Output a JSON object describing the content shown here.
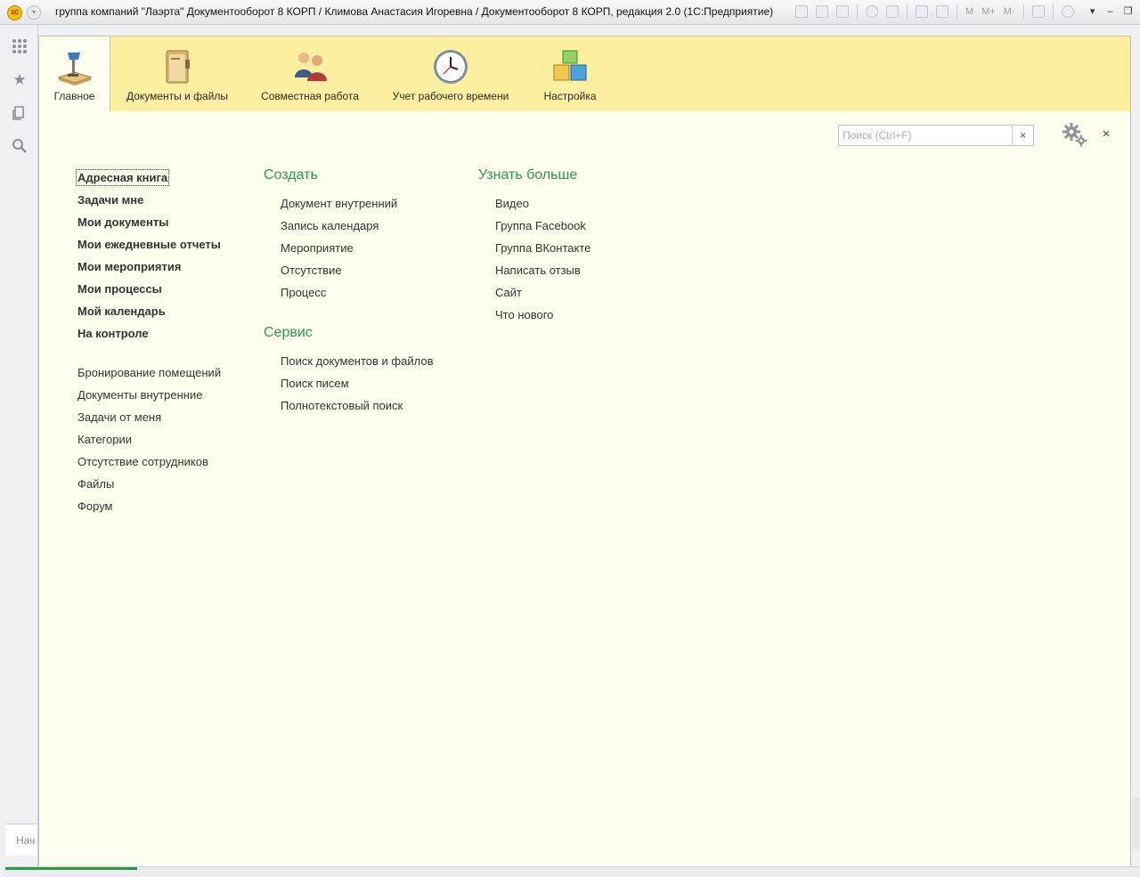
{
  "window": {
    "title": "группа компаний \"Лаэрта\" Документооборот 8 КОРП / Климова Анастасия Игоревна / Документооборот 8 КОРП, редакция 2.0  (1С:Предприятие)",
    "logo_text": "1С",
    "toolbar_text": [
      "M",
      "M+",
      "M-"
    ]
  },
  "sections": [
    {
      "label": "Главное",
      "icon": "desk-lamp-icon",
      "active": true
    },
    {
      "label": "Документы и файлы",
      "icon": "folder-icon",
      "active": false
    },
    {
      "label": "Совместная работа",
      "icon": "people-icon",
      "active": false
    },
    {
      "label": "Учет рабочего времени",
      "icon": "clock-icon",
      "active": false
    },
    {
      "label": "Настройка",
      "icon": "cubes-icon",
      "active": false
    }
  ],
  "search": {
    "placeholder": "Поиск (Ctrl+F)",
    "value": "",
    "clear": "×"
  },
  "close_label": "×",
  "main_links": [
    {
      "label": "Адресная книга",
      "bold": true
    },
    {
      "label": "Задачи мне",
      "bold": true
    },
    {
      "label": "Мои документы",
      "bold": true
    },
    {
      "label": "Мои ежедневные отчеты",
      "bold": true
    },
    {
      "label": "Мои мероприятия",
      "bold": true
    },
    {
      "label": "Мои процессы",
      "bold": true
    },
    {
      "label": "Мой календарь",
      "bold": true
    },
    {
      "label": "На контроле",
      "bold": true
    }
  ],
  "secondary_links": [
    {
      "label": "Бронирование помещений"
    },
    {
      "label": "Документы внутренние"
    },
    {
      "label": "Задачи от меня"
    },
    {
      "label": "Категории"
    },
    {
      "label": "Отсутствие сотрудников"
    },
    {
      "label": "Файлы"
    },
    {
      "label": "Форум"
    }
  ],
  "create": {
    "title": "Создать",
    "items": [
      "Документ внутренний",
      "Запись календаря",
      "Мероприятие",
      "Отсутствие",
      "Процесс"
    ]
  },
  "service": {
    "title": "Сервис",
    "items": [
      "Поиск документов и файлов",
      "Поиск писем",
      "Полнотекстовый поиск"
    ]
  },
  "learn_more": {
    "title": "Узнать больше",
    "items": [
      "Видео",
      "Группа Facebook",
      "Группа ВКонтакте",
      "Написать отзыв",
      "Сайт",
      "Что нового"
    ]
  },
  "bottom_tab": {
    "label": "Нач"
  }
}
